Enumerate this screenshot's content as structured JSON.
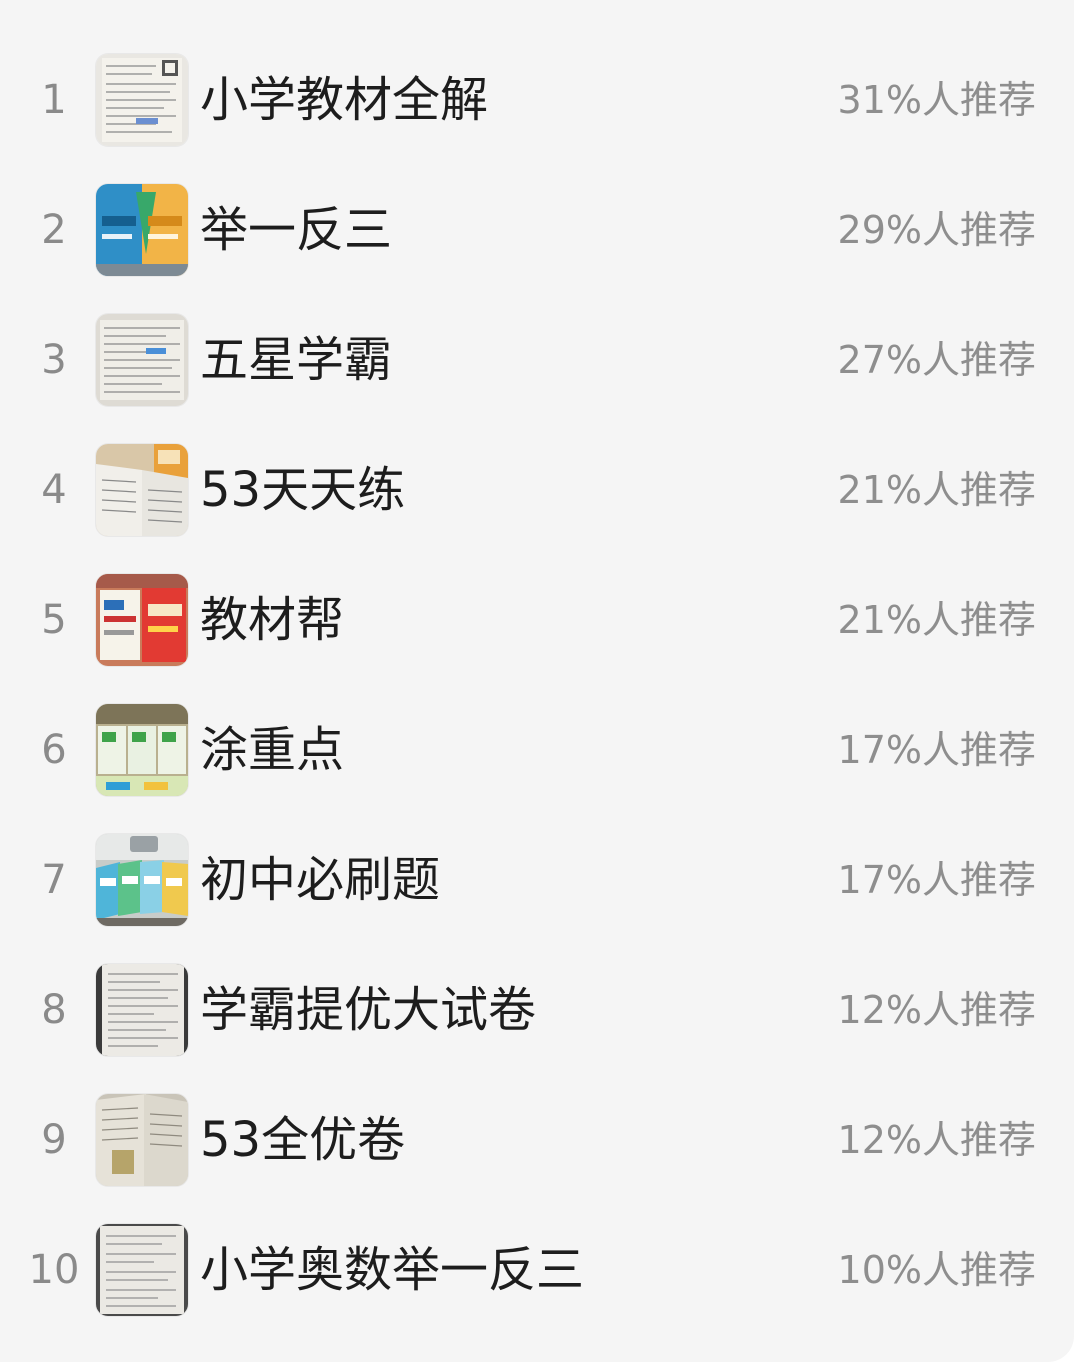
{
  "ranking": {
    "items": [
      {
        "rank": "1",
        "name": "小学教材全解",
        "percent": "31%人推荐",
        "thumb": "book-page-photo"
      },
      {
        "rank": "2",
        "name": "举一反三",
        "percent": "29%人推荐",
        "thumb": "book-covers-photo"
      },
      {
        "rank": "3",
        "name": "五星学霸",
        "percent": "27%人推荐",
        "thumb": "book-page-photo"
      },
      {
        "rank": "4",
        "name": "53天天练",
        "percent": "21%人推荐",
        "thumb": "open-book-photo"
      },
      {
        "rank": "5",
        "name": "教材帮",
        "percent": "21%人推荐",
        "thumb": "book-covers-photo"
      },
      {
        "rank": "6",
        "name": "涂重点",
        "percent": "17%人推荐",
        "thumb": "book-stack-photo"
      },
      {
        "rank": "7",
        "name": "初中必刷题",
        "percent": "17%人推荐",
        "thumb": "book-stack-photo"
      },
      {
        "rank": "8",
        "name": "学霸提优大试卷",
        "percent": "12%人推荐",
        "thumb": "book-page-photo"
      },
      {
        "rank": "9",
        "name": "53全优卷",
        "percent": "12%人推荐",
        "thumb": "book-page-photo"
      },
      {
        "rank": "10",
        "name": "小学奥数举一反三",
        "percent": "10%人推荐",
        "thumb": "book-page-photo"
      }
    ]
  },
  "colors": {
    "background": "#f5f5f5",
    "name_text": "#1d1d1d",
    "muted_text": "#8e8e8e"
  }
}
